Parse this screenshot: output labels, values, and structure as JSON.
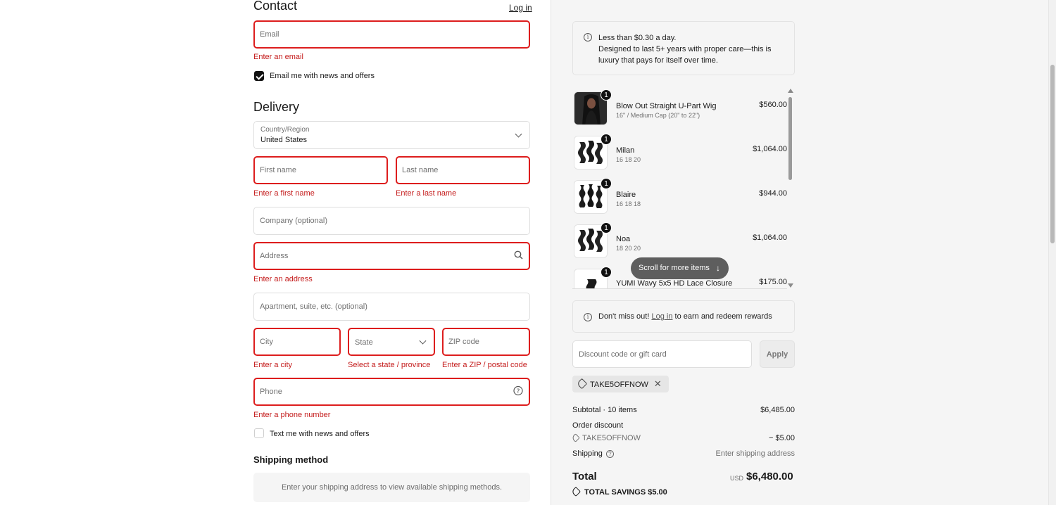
{
  "contact": {
    "title": "Contact",
    "login_link": "Log in",
    "email_placeholder": "Email",
    "email_error": "Enter an email",
    "email_news_label": "Email me with news and offers",
    "email_news_checked": true
  },
  "delivery": {
    "title": "Delivery",
    "country_label": "Country/Region",
    "country_value": "United States",
    "first_name_placeholder": "First name",
    "first_name_error": "Enter a first name",
    "last_name_placeholder": "Last name",
    "last_name_error": "Enter a last name",
    "company_placeholder": "Company (optional)",
    "address_placeholder": "Address",
    "address_error": "Enter an address",
    "apartment_placeholder": "Apartment, suite, etc. (optional)",
    "city_placeholder": "City",
    "city_error": "Enter a city",
    "state_placeholder": "State",
    "state_error": "Select a state / province",
    "zip_placeholder": "ZIP code",
    "zip_error": "Enter a ZIP / postal code",
    "phone_placeholder": "Phone",
    "phone_error": "Enter a phone number",
    "text_news_label": "Text me with news and offers",
    "text_news_checked": false
  },
  "shipping_method": {
    "title": "Shipping method",
    "message": "Enter your shipping address to view available shipping methods."
  },
  "summary": {
    "notice_line1": "Less than $0.30 a day.",
    "notice_line2": "Designed to last 5+ years with proper care—this is luxury that pays for itself over time.",
    "items": [
      {
        "name": "Blow Out Straight U-Part Wig",
        "variant": "16\" / Medium Cap (20\" to 22\")",
        "price": "$560.00",
        "qty": "1",
        "image": "wig-photo"
      },
      {
        "name": "Milan",
        "variant": "16 18 20",
        "price": "$1,064.00",
        "qty": "1",
        "image": "wavy-bundles"
      },
      {
        "name": "Blaire",
        "variant": "16 18 18",
        "price": "$944.00",
        "qty": "1",
        "image": "curly-bundles"
      },
      {
        "name": "Noa",
        "variant": "18 20 20",
        "price": "$1,064.00",
        "qty": "1",
        "image": "wavy-bundles"
      },
      {
        "name": "YUMI Wavy 5x5 HD Lace Closure",
        "variant": "",
        "price": "$175.00",
        "qty": "1",
        "image": "closure"
      }
    ],
    "scroll_hint": "Scroll for more items",
    "rewards_prefix": "Don't miss out!",
    "rewards_link": "Log in",
    "rewards_suffix": "to earn and redeem rewards",
    "discount_placeholder": "Discount code or gift card",
    "apply_label": "Apply",
    "applied_code": "TAKE5OFFNOW",
    "subtotal_label": "Subtotal · 10 items",
    "subtotal_value": "$6,485.00",
    "order_discount_label": "Order discount",
    "order_discount_code": "TAKE5OFFNOW",
    "order_discount_value": "− $5.00",
    "shipping_label": "Shipping",
    "shipping_value": "Enter shipping address",
    "total_label": "Total",
    "currency": "USD",
    "total_value": "$6,480.00",
    "savings_label": "TOTAL SAVINGS",
    "savings_value": "$5.00"
  },
  "colors": {
    "error": "#dd1d1d",
    "error_text": "#c41b1b",
    "summary_bg": "#f5f5f5"
  }
}
